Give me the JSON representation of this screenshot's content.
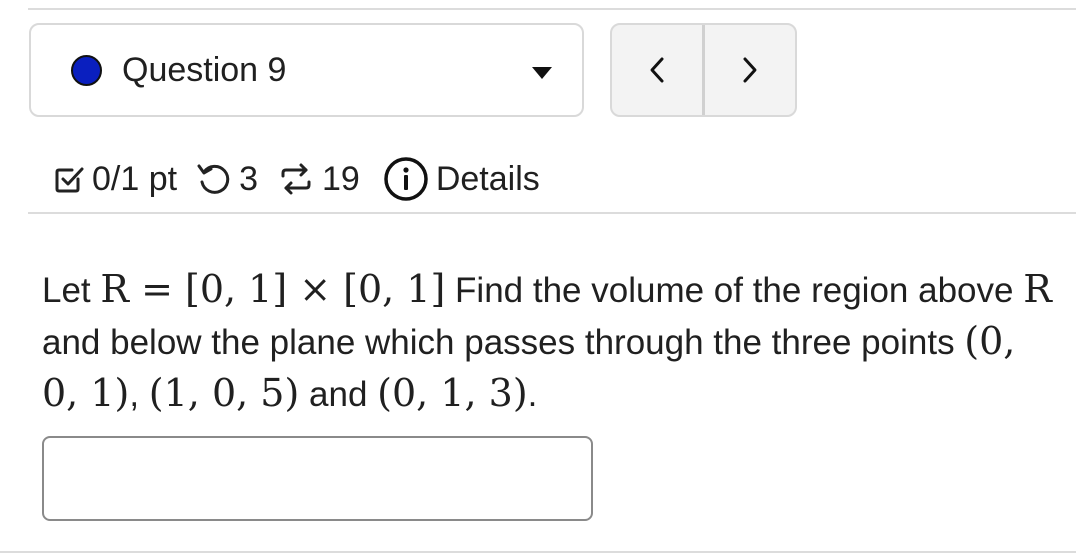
{
  "question": {
    "label": "Question 9"
  },
  "nav": {
    "prev_icon": "chevron-left-icon",
    "next_icon": "chevron-right-icon"
  },
  "meta": {
    "score": "0/1 pt",
    "retries": "3",
    "attempts": "19",
    "details": "Details"
  },
  "problem": {
    "t1": "Let ",
    "m1": "R = [0, 1] × [0, 1]",
    "t2": " Find the volume of the region above ",
    "m2": "R",
    "t3": " and below the plane which passes through the three points ",
    "m3": "(0, 0, 1)",
    "t4": ", ",
    "m4": "(1, 0, 5)",
    "t5": " and ",
    "m5": "(0, 1, 3)",
    "t6": "."
  },
  "answer": {
    "value": ""
  },
  "colors": {
    "status_dot": "#0a1fbf",
    "border": "#d9d9d9"
  }
}
